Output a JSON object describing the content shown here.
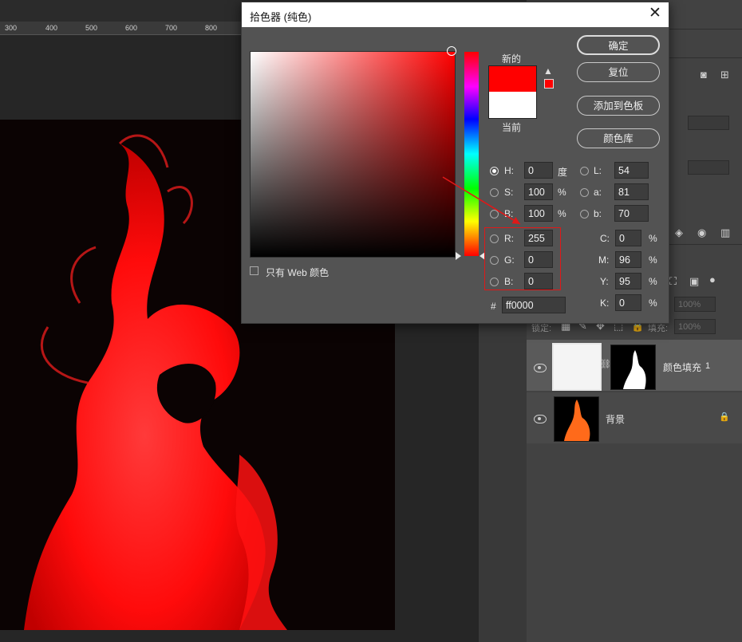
{
  "ruler": {
    "ticks": [
      "300",
      "400",
      "500",
      "600",
      "700",
      "800"
    ]
  },
  "dialog": {
    "title": "拾色器 (纯色)",
    "close": "✕",
    "buttons": {
      "ok": "确定",
      "reset": "复位",
      "add_to_swatches": "添加到色板",
      "color_libraries": "颜色库"
    },
    "swatch_labels": {
      "new": "新的",
      "current": "当前"
    },
    "new_color": "#ff0000",
    "current_color": "#ffffff",
    "warning_icon": "warning-triangle-icon",
    "only_web_colors": "只有 Web 颜色",
    "hsb": [
      {
        "label": "H:",
        "value": "0",
        "unit": "度",
        "selected": true
      },
      {
        "label": "S:",
        "value": "100",
        "unit": "%",
        "selected": false
      },
      {
        "label": "B:",
        "value": "100",
        "unit": "%",
        "selected": false
      }
    ],
    "rgb": [
      {
        "label": "R:",
        "value": "255"
      },
      {
        "label": "G:",
        "value": "0"
      },
      {
        "label": "B:",
        "value": "0"
      }
    ],
    "lab": [
      {
        "label": "L:",
        "value": "54"
      },
      {
        "label": "a:",
        "value": "81"
      },
      {
        "label": "b:",
        "value": "70"
      }
    ],
    "cmyk": [
      {
        "label": "C:",
        "value": "0",
        "unit": "%"
      },
      {
        "label": "M:",
        "value": "96",
        "unit": "%"
      },
      {
        "label": "Y:",
        "value": "95",
        "unit": "%"
      },
      {
        "label": "K:",
        "value": "0",
        "unit": "%"
      }
    ],
    "hex_label": "#",
    "hex_value": "ff0000"
  },
  "layers_panel": {
    "lock_label": "锁定:",
    "fill_label": "填充:",
    "opacity_value": "100%",
    "fill_value": "100%",
    "layers": [
      {
        "name": "颜色填充",
        "suffix": "1",
        "selected": true
      },
      {
        "name": "背景",
        "locked": true,
        "selected": false
      }
    ]
  },
  "colors": {
    "accent_red": "#ff0000",
    "highlight_box": "#e01818"
  }
}
